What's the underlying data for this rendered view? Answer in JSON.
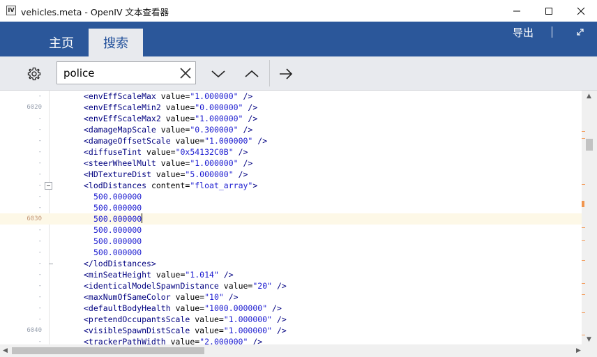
{
  "window": {
    "app_icon_text": "IV",
    "title": "vehicles.meta - OpenIV 文本查看器"
  },
  "ribbon": {
    "tabs": [
      {
        "label": "主页",
        "active": false
      },
      {
        "label": "搜索",
        "active": true
      }
    ],
    "export_label": "导出",
    "separator": "|"
  },
  "toolbar": {
    "search_value": "police",
    "search_placeholder": ""
  },
  "editor": {
    "lines": [
      {
        "num": "-",
        "indent": "",
        "code": [
          {
            "t": "tag",
            "s": "<envEffScaleMax "
          },
          {
            "t": "attr",
            "s": "value="
          },
          {
            "t": "val",
            "s": "\"1.000000\""
          },
          {
            "t": "tag",
            "s": " />"
          }
        ]
      },
      {
        "num": "6020",
        "indent": "",
        "code": [
          {
            "t": "tag",
            "s": "<envEffScaleMin2 "
          },
          {
            "t": "attr",
            "s": "value="
          },
          {
            "t": "val",
            "s": "\"0.000000\""
          },
          {
            "t": "tag",
            "s": " />"
          }
        ]
      },
      {
        "num": "-",
        "indent": "",
        "code": [
          {
            "t": "tag",
            "s": "<envEffScaleMax2 "
          },
          {
            "t": "attr",
            "s": "value="
          },
          {
            "t": "val",
            "s": "\"1.000000\""
          },
          {
            "t": "tag",
            "s": " />"
          }
        ]
      },
      {
        "num": "-",
        "indent": "",
        "code": [
          {
            "t": "tag",
            "s": "<damageMapScale "
          },
          {
            "t": "attr",
            "s": "value="
          },
          {
            "t": "val",
            "s": "\"0.300000\""
          },
          {
            "t": "tag",
            "s": " />"
          }
        ]
      },
      {
        "num": "-",
        "indent": "",
        "code": [
          {
            "t": "tag",
            "s": "<damageOffsetScale "
          },
          {
            "t": "attr",
            "s": "value="
          },
          {
            "t": "val",
            "s": "\"1.000000\""
          },
          {
            "t": "tag",
            "s": " />"
          }
        ]
      },
      {
        "num": "-",
        "indent": "",
        "code": [
          {
            "t": "tag",
            "s": "<diffuseTint "
          },
          {
            "t": "attr",
            "s": "value="
          },
          {
            "t": "val",
            "s": "\"0x54132C0B\""
          },
          {
            "t": "tag",
            "s": " />"
          }
        ]
      },
      {
        "num": "-",
        "indent": "",
        "code": [
          {
            "t": "tag",
            "s": "<steerWheelMult "
          },
          {
            "t": "attr",
            "s": "value="
          },
          {
            "t": "val",
            "s": "\"1.000000\""
          },
          {
            "t": "tag",
            "s": " />"
          }
        ]
      },
      {
        "num": "-",
        "indent": "",
        "code": [
          {
            "t": "tag",
            "s": "<HDTextureDist "
          },
          {
            "t": "attr",
            "s": "value="
          },
          {
            "t": "val",
            "s": "\"5.000000\""
          },
          {
            "t": "tag",
            "s": " />"
          }
        ]
      },
      {
        "num": "-",
        "indent": "",
        "fold": "open",
        "code": [
          {
            "t": "tag",
            "s": "<lodDistances "
          },
          {
            "t": "attr",
            "s": "content="
          },
          {
            "t": "val",
            "s": "\"float_array\""
          },
          {
            "t": "tag",
            "s": ">"
          }
        ]
      },
      {
        "num": "-",
        "indent": "  ",
        "code": [
          {
            "t": "num",
            "s": "500.000000"
          }
        ]
      },
      {
        "num": "-",
        "indent": "  ",
        "code": [
          {
            "t": "num",
            "s": "500.000000"
          }
        ]
      },
      {
        "num": "6030",
        "indent": "  ",
        "current": true,
        "code": [
          {
            "t": "num",
            "s": "500.000000"
          }
        ]
      },
      {
        "num": "-",
        "indent": "  ",
        "code": [
          {
            "t": "num",
            "s": "500.000000"
          }
        ]
      },
      {
        "num": "-",
        "indent": "  ",
        "code": [
          {
            "t": "num",
            "s": "500.000000"
          }
        ]
      },
      {
        "num": "-",
        "indent": "  ",
        "code": [
          {
            "t": "num",
            "s": "500.000000"
          }
        ]
      },
      {
        "num": "-",
        "indent": "",
        "fold": "end",
        "code": [
          {
            "t": "tag",
            "s": "</lodDistances>"
          }
        ]
      },
      {
        "num": "-",
        "indent": "",
        "code": [
          {
            "t": "tag",
            "s": "<minSeatHeight "
          },
          {
            "t": "attr",
            "s": "value="
          },
          {
            "t": "val",
            "s": "\"1.014\""
          },
          {
            "t": "tag",
            "s": " />"
          }
        ]
      },
      {
        "num": "-",
        "indent": "",
        "code": [
          {
            "t": "tag",
            "s": "<identicalModelSpawnDistance "
          },
          {
            "t": "attr",
            "s": "value="
          },
          {
            "t": "val",
            "s": "\"20\""
          },
          {
            "t": "tag",
            "s": " />"
          }
        ]
      },
      {
        "num": "-",
        "indent": "",
        "code": [
          {
            "t": "tag",
            "s": "<maxNumOfSameColor "
          },
          {
            "t": "attr",
            "s": "value="
          },
          {
            "t": "val",
            "s": "\"10\""
          },
          {
            "t": "tag",
            "s": " />"
          }
        ]
      },
      {
        "num": "-",
        "indent": "",
        "code": [
          {
            "t": "tag",
            "s": "<defaultBodyHealth "
          },
          {
            "t": "attr",
            "s": "value="
          },
          {
            "t": "val",
            "s": "\"1000.000000\""
          },
          {
            "t": "tag",
            "s": " />"
          }
        ]
      },
      {
        "num": "-",
        "indent": "",
        "code": [
          {
            "t": "tag",
            "s": "<pretendOccupantsScale "
          },
          {
            "t": "attr",
            "s": "value="
          },
          {
            "t": "val",
            "s": "\"1.000000\""
          },
          {
            "t": "tag",
            "s": " />"
          }
        ]
      },
      {
        "num": "6040",
        "indent": "",
        "code": [
          {
            "t": "tag",
            "s": "<visibleSpawnDistScale "
          },
          {
            "t": "attr",
            "s": "value="
          },
          {
            "t": "val",
            "s": "\"1.000000\""
          },
          {
            "t": "tag",
            "s": " />"
          }
        ]
      },
      {
        "num": "-",
        "indent": "",
        "code": [
          {
            "t": "tag",
            "s": "<trackerPathWidth "
          },
          {
            "t": "attr",
            "s": "value="
          },
          {
            "t": "val",
            "s": "\"2.000000\""
          },
          {
            "t": "tag",
            "s": " />"
          }
        ]
      }
    ]
  },
  "colors": {
    "ribbon": "#2b579a",
    "toolbar": "#e8eaee",
    "tag": "#000080",
    "value": "#1a1ad0",
    "current_line": "#fdf8e7",
    "search_marker": "#f39b5a"
  },
  "icons": {
    "settings": "gear-icon",
    "clear": "close-icon",
    "next": "chevron-down-icon",
    "previous": "chevron-up-icon",
    "go": "arrow-right-icon",
    "expand": "expand-icon"
  }
}
